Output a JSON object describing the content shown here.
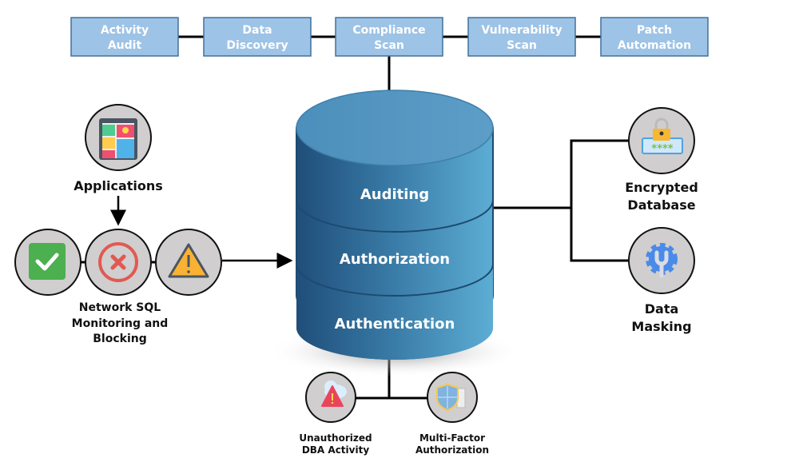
{
  "top_modules": [
    {
      "line1": "Activity",
      "line2": "Audit"
    },
    {
      "line1": "Data",
      "line2": "Discovery"
    },
    {
      "line1": "Compliance",
      "line2": "Scan"
    },
    {
      "line1": "Vulnerability",
      "line2": "Scan"
    },
    {
      "line1": "Patch",
      "line2": "Automation"
    }
  ],
  "database_layers": [
    "Auditing",
    "Authorization",
    "Authentication"
  ],
  "left": {
    "applications": {
      "label": "Applications",
      "icon": "mobile-app-icon"
    },
    "network": {
      "label_lines": [
        "Network SQL",
        "Monitoring and",
        "Blocking"
      ],
      "icons": [
        "check-icon",
        "blocked-x-icon",
        "warning-icon"
      ]
    }
  },
  "right": [
    {
      "label_lines": [
        "Encrypted",
        "Database"
      ],
      "icon": "lock-password-icon"
    },
    {
      "label_lines": [
        "Data",
        "Masking"
      ],
      "icon": "gear-wrench-icon"
    }
  ],
  "bottom": [
    {
      "label_lines": [
        "Unauthorized",
        "DBA Activity"
      ],
      "icon": "cloud-alert-icon"
    },
    {
      "label_lines": [
        "Multi-Factor",
        "Authorization"
      ],
      "icon": "shield-checklist-icon"
    }
  ],
  "colors": {
    "box_fill": "#9dc3e6",
    "box_border": "#41719c",
    "db_dark": "#1f4e79",
    "db_light": "#5ba7cf",
    "circle_fill": "#d0cece"
  }
}
